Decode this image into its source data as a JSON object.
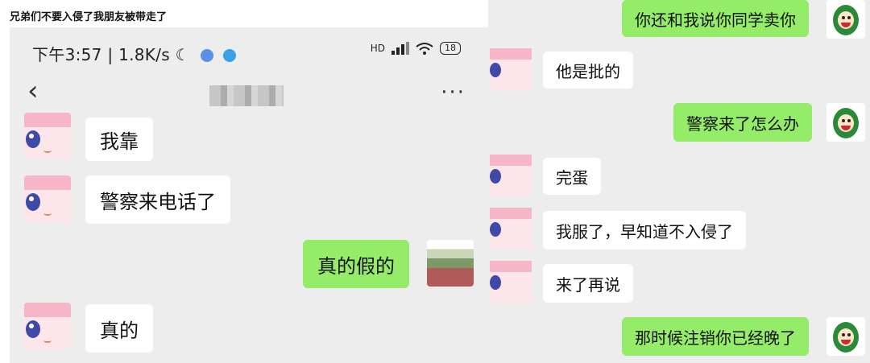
{
  "caption": "兄弟们不要入侵了我朋友被带走了",
  "left_phone": {
    "status": {
      "time": "下午3:57",
      "net_speed": "1.8K/s",
      "moon_icon": "☾",
      "signal_label": "HD",
      "battery": "18"
    },
    "header": {
      "back_glyph": "‹",
      "more_glyph": "···"
    },
    "messages": [
      {
        "side": "left",
        "text": "我靠"
      },
      {
        "side": "left",
        "text": "警察来电话了"
      },
      {
        "side": "right",
        "text": "真的假的"
      },
      {
        "side": "left",
        "text": "真的"
      }
    ]
  },
  "right_phone": {
    "messages": [
      {
        "side": "right",
        "text": "你还和我说你同学卖你"
      },
      {
        "side": "left",
        "text": "他是批的"
      },
      {
        "side": "right",
        "text": "警察来了怎么办"
      },
      {
        "side": "left",
        "text": "完蛋"
      },
      {
        "side": "left",
        "text": "我服了，早知道不入侵了"
      },
      {
        "side": "left",
        "text": "来了再说"
      },
      {
        "side": "right",
        "text": "那时候注销你已经晚了"
      }
    ]
  },
  "colors": {
    "chat_bg": "#ededed",
    "bubble_green": "#95ec69",
    "bubble_white": "#ffffff"
  }
}
